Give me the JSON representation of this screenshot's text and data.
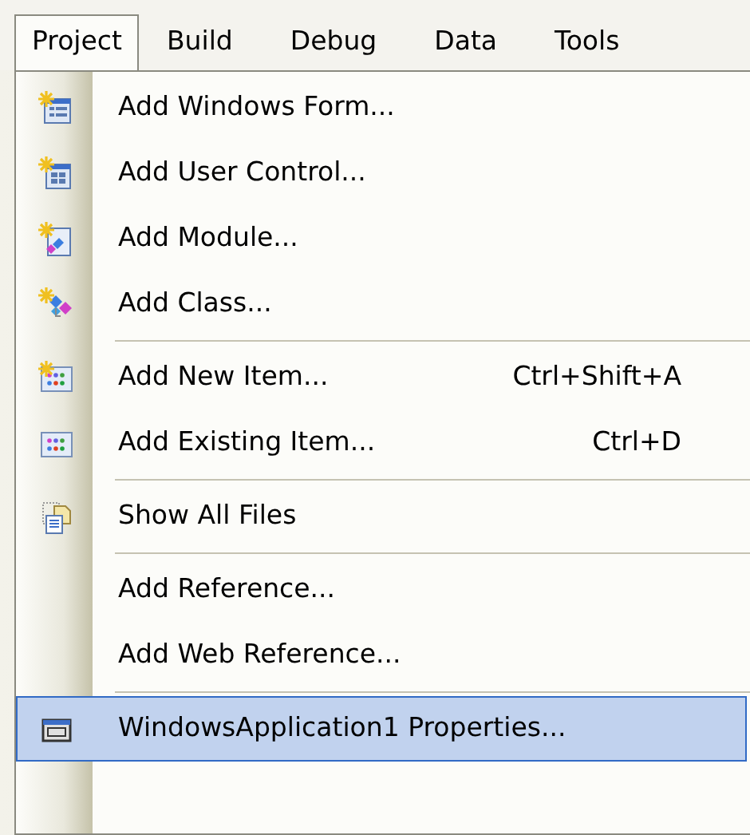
{
  "menu_bar": [
    {
      "label": "Project",
      "selected": true
    },
    {
      "label": "Build",
      "selected": false
    },
    {
      "label": "Debug",
      "selected": false
    },
    {
      "label": "Data",
      "selected": false
    },
    {
      "label": "Tools",
      "selected": false
    }
  ],
  "menu": {
    "items": [
      {
        "kind": "item",
        "label": "Add Windows Form...",
        "selected": false
      },
      {
        "kind": "item",
        "label": "Add User Control...",
        "selected": false
      },
      {
        "kind": "item",
        "label": "Add Module...",
        "selected": false
      },
      {
        "kind": "item",
        "label": "Add Class...",
        "selected": false
      },
      {
        "kind": "separator"
      },
      {
        "kind": "item",
        "label": "Add New Item...",
        "shortcut": "Ctrl+Shift+A",
        "selected": false
      },
      {
        "kind": "item",
        "label": "Add Existing Item...",
        "shortcut": "Ctrl+D",
        "selected": false
      },
      {
        "kind": "separator"
      },
      {
        "kind": "item",
        "label": "Show All Files",
        "selected": false
      },
      {
        "kind": "separator"
      },
      {
        "kind": "item",
        "label": "Add Reference...",
        "selected": false
      },
      {
        "kind": "item",
        "label": "Add Web Reference...",
        "selected": false
      },
      {
        "kind": "separator"
      },
      {
        "kind": "item",
        "label": "WindowsApplication1 Properties...",
        "selected": true
      }
    ]
  }
}
